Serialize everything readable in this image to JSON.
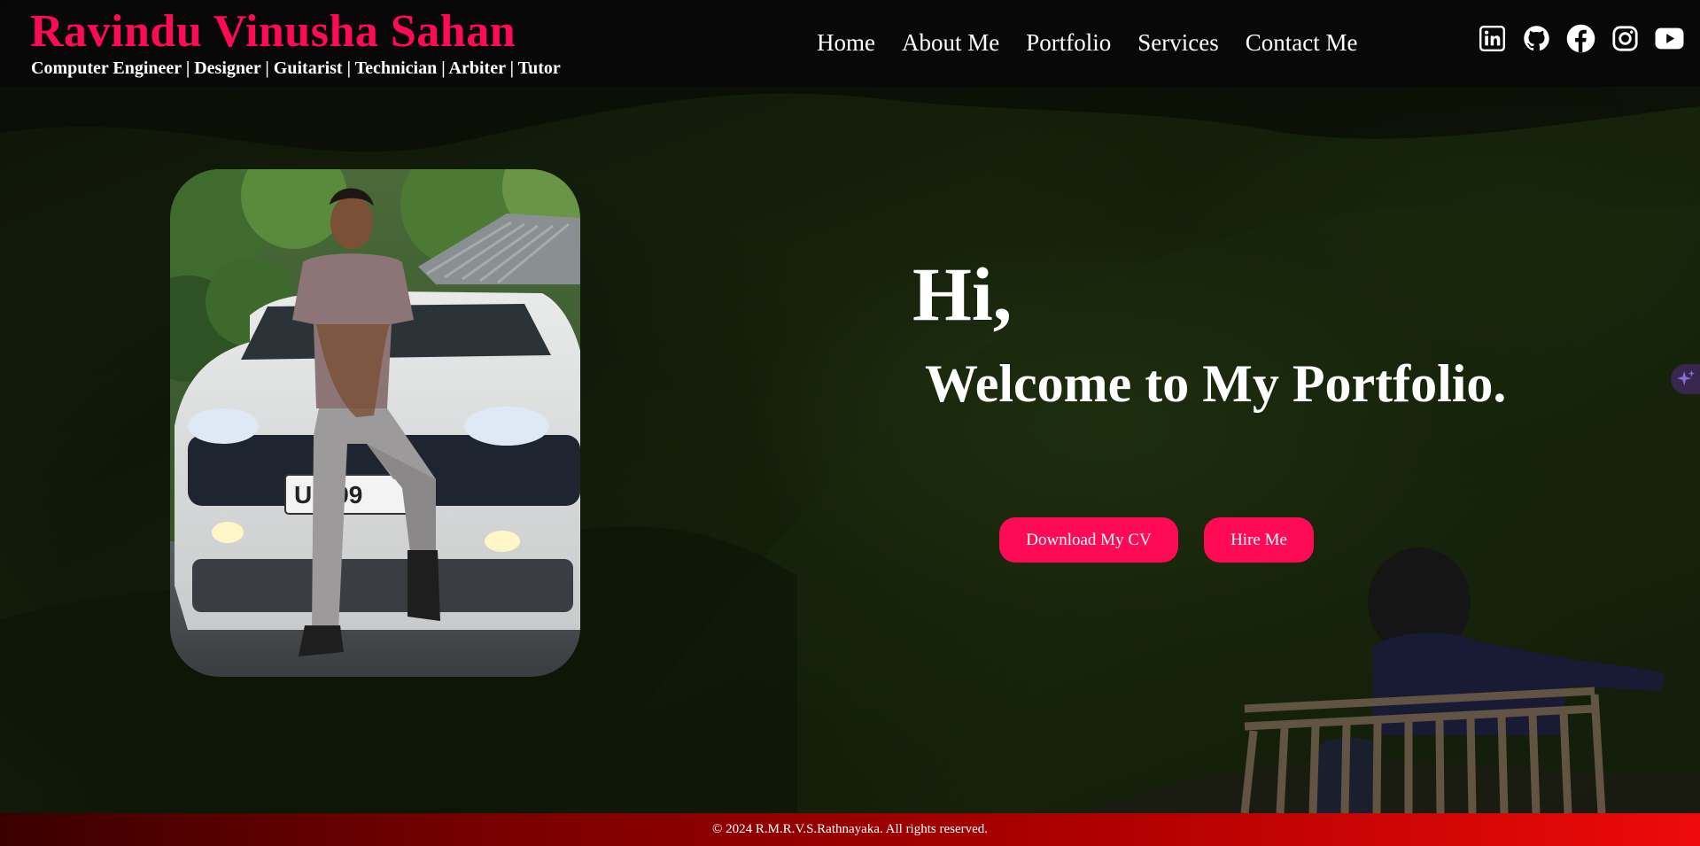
{
  "header": {
    "name": "Ravindu Vinusha Sahan",
    "tagline": "Computer Engineer | Designer | Guitarist | Technician | Arbiter | Tutor",
    "nav": [
      {
        "label": "Home"
      },
      {
        "label": "About Me"
      },
      {
        "label": "Portfolio"
      },
      {
        "label": "Services"
      },
      {
        "label": "Contact Me"
      }
    ],
    "socials": [
      {
        "icon": "linkedin-icon"
      },
      {
        "icon": "github-icon"
      },
      {
        "icon": "facebook-icon"
      },
      {
        "icon": "instagram-icon"
      },
      {
        "icon": "youtube-icon"
      }
    ]
  },
  "hero": {
    "greeting": "Hi,",
    "headline": "Welcome to My Portfolio.",
    "download_cv_label": "Download My CV",
    "hire_me_label": "Hire Me",
    "plate_text": "UP 99"
  },
  "footer": {
    "copyright": "© 2024 R.M.R.V.S.Rathnayaka. All rights reserved."
  },
  "colors": {
    "accent": "#ff0a55",
    "header_bg": "#080808",
    "footer_start": "#3a0000",
    "footer_end": "#ee0a0a"
  }
}
